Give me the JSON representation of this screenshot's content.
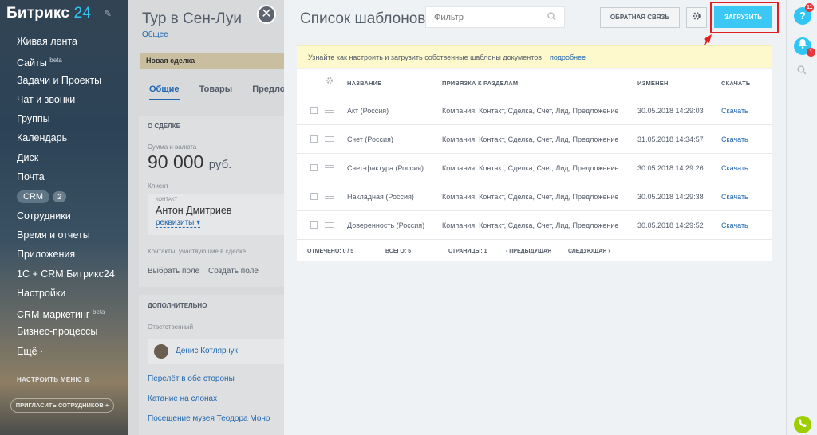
{
  "sidebar": {
    "logo_text": "Битрикс",
    "logo_num": "24",
    "items": [
      {
        "label": "Живая лента"
      },
      {
        "label": "Сайты",
        "sup": "beta"
      },
      {
        "label": "Задачи и Проекты"
      },
      {
        "label": "Чат и звонки"
      },
      {
        "label": "Группы"
      },
      {
        "label": "Календарь"
      },
      {
        "label": "Диск"
      },
      {
        "label": "Почта"
      },
      {
        "label": "CRM",
        "count": "2"
      },
      {
        "label": "Сотрудники"
      },
      {
        "label": "Время и отчеты"
      },
      {
        "label": "Приложения"
      },
      {
        "label": "1С + CRM Битрикс24"
      },
      {
        "label": "Настройки"
      },
      {
        "label": "CRM-маркетинг",
        "sup": "beta"
      },
      {
        "label": "Бизнес-процессы"
      },
      {
        "label": "Ещё ·"
      }
    ],
    "setup_menu": "НАСТРОИТЬ МЕНЮ",
    "invite": "ПРИГЛАСИТЬ СОТРУДНИКОВ"
  },
  "deal": {
    "title": "Тур в Сен-Луи",
    "subtitle": "Общее",
    "stage": "Новая сделка",
    "tabs": [
      "Общие",
      "Товары",
      "Предложе"
    ],
    "about_header": "О СДЕЛКЕ",
    "amount_label": "Сумма и валюта",
    "amount": "90 000",
    "currency": "руб.",
    "client_label": "Клиент",
    "contact_type": "КОНТАКТ",
    "client_name": "Антон Дмитриев",
    "requisites": "реквизиты",
    "contacts_label": "Контакты, участвующие в сделке",
    "select_field": "Выбрать поле",
    "create_field": "Создать поле",
    "extra_header": "ДОПОЛНИТЕЛЬНО",
    "responsible_label": "Ответственный",
    "responsible_name": "Денис Котлярчук",
    "products": [
      "Перелёт в обе стороны",
      "Катание на слонах",
      "Посещение музея Теодора Моно"
    ]
  },
  "slider": {
    "title": "Список шаблонов",
    "filter_placeholder": "Фильтр",
    "feedback": "ОБРАТНАЯ СВЯЗЬ",
    "upload": "ЗАГРУЗИТЬ",
    "notice_text": "Узнайте как настроить и загрузить собственные шаблоны документов",
    "notice_link": "подробнее",
    "columns": [
      "НАЗВАНИЕ",
      "ПРИВЯЗКА К РАЗДЕЛАМ",
      "ИЗМЕНЕН",
      "СКАЧАТЬ"
    ],
    "rows": [
      {
        "name": "Акт (Россия)",
        "sections": "Компания, Контакт, Сделка, Счет, Лид, Предложение",
        "modified": "30.05.2018 14:29:03",
        "download": "Скачать"
      },
      {
        "name": "Счет (Россия)",
        "sections": "Компания, Контакт, Сделка, Счет, Лид, Предложение",
        "modified": "31.05.2018 14:34:57",
        "download": "Скачать"
      },
      {
        "name": "Счет-фактура (Россия)",
        "sections": "Компания, Контакт, Сделка, Счет, Лид, Предложение",
        "modified": "30.05.2018 14:29:26",
        "download": "Скачать"
      },
      {
        "name": "Накладная (Россия)",
        "sections": "Компания, Контакт, Сделка, Счет, Лид, Предложение",
        "modified": "30.05.2018 14:29:38",
        "download": "Скачать"
      },
      {
        "name": "Доверенность (Россия)",
        "sections": "Компания, Контакт, Сделка, Счет, Лид, Предложение",
        "modified": "30.05.2018 14:29:52",
        "download": "Скачать"
      }
    ],
    "footer": {
      "marked": "ОТМЕЧЕНО: 0 / 5",
      "total": "ВСЕГО: 5",
      "pages": "СТРАНИЦЫ: 1",
      "prev": "‹ ПРЕДЫДУЩАЯ",
      "next": "СЛЕДУЮЩАЯ ›"
    }
  },
  "rightbar": {
    "help_badge": "11",
    "notif_badge": "1"
  },
  "colors": {
    "accent": "#3bc8f5",
    "link": "#2067b0",
    "highlight": "#e02020"
  }
}
